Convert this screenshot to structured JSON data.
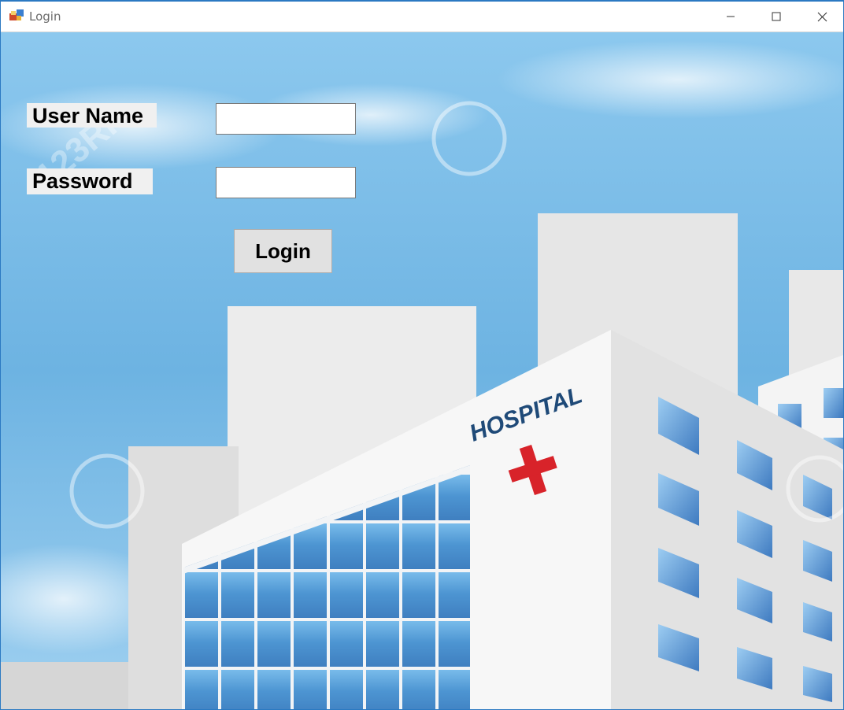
{
  "window": {
    "title": "Login",
    "controls": {
      "minimize": "minimize-icon",
      "maximize": "maximize-icon",
      "close": "close-icon"
    }
  },
  "form": {
    "username_label": "User Name",
    "username_value": "",
    "password_label": "Password",
    "password_value": "",
    "login_button": "Login"
  },
  "background": {
    "sign_text": "HOSPITAL",
    "watermark_text": "123RF",
    "sky_color": "#6fb4e3",
    "cross_color": "#d8232a"
  }
}
